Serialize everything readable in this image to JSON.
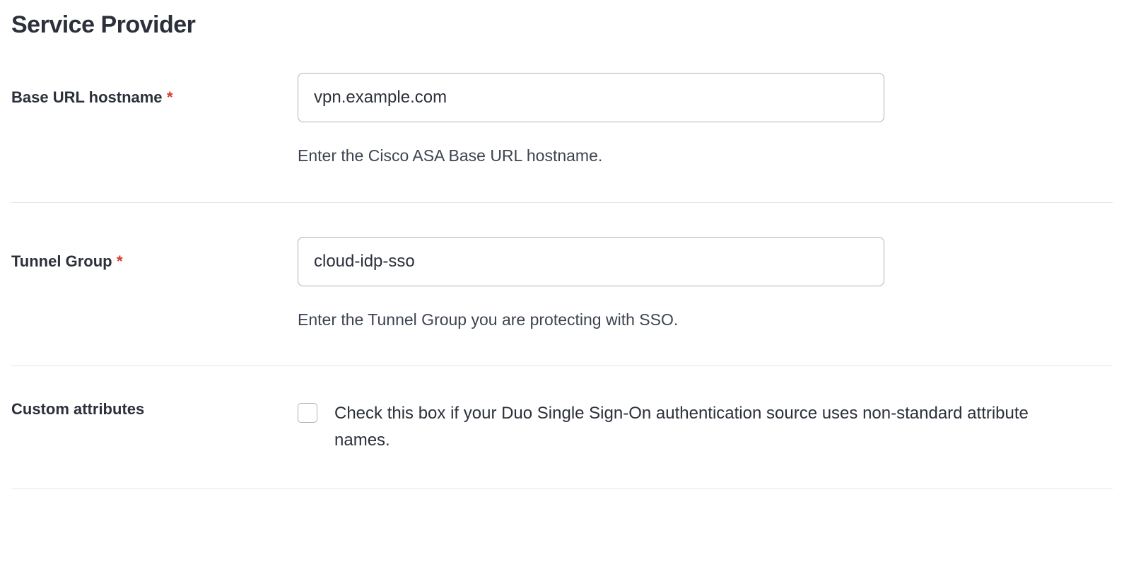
{
  "section": {
    "title": "Service Provider"
  },
  "fields": {
    "baseUrl": {
      "label": "Base URL hostname",
      "required": true,
      "value": "vpn.example.com",
      "help": "Enter the Cisco ASA Base URL hostname."
    },
    "tunnelGroup": {
      "label": "Tunnel Group",
      "required": true,
      "value": "cloud-idp-sso",
      "help": "Enter the Tunnel Group you are protecting with SSO."
    },
    "customAttributes": {
      "label": "Custom attributes",
      "checkboxLabel": "Check this box if your Duo Single Sign-On authentication source uses non-standard attribute names."
    }
  },
  "requiredMark": "*"
}
